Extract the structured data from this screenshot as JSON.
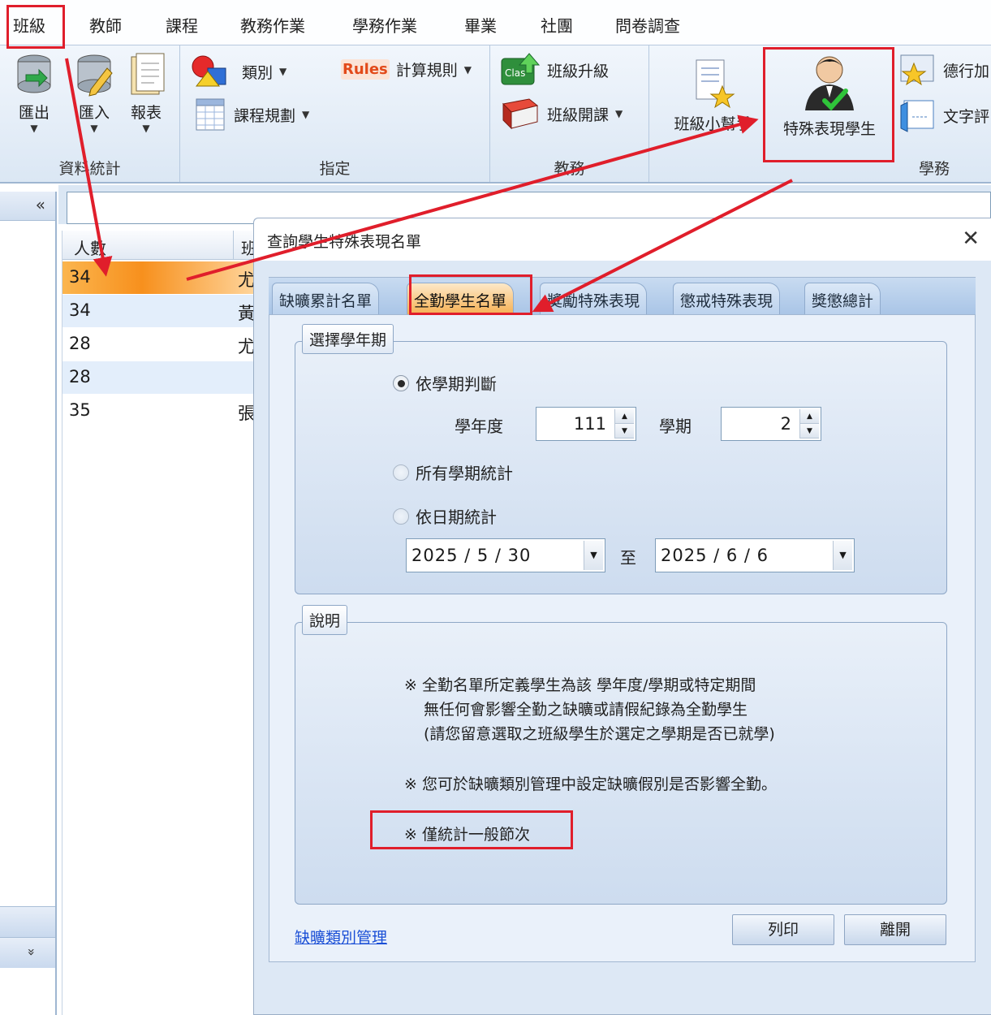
{
  "menu": {
    "items": [
      "班級",
      "教師",
      "課程",
      "教務作業",
      "學務作業",
      "畢業",
      "社團",
      "問卷調查"
    ]
  },
  "ribbon": {
    "data_stats": {
      "label": "資料統計",
      "export": "匯出",
      "import": "匯入",
      "report": "報表"
    },
    "assign": {
      "label": "指定",
      "category": "類別",
      "calc_rules": "計算規則",
      "rules_icon_text": "Rules",
      "course_plan": "課程規劃"
    },
    "academic": {
      "label": "教務",
      "class_upgrade": "班級升級",
      "class_open": "班級開課",
      "class_icon_text": "Clas"
    },
    "student_affairs": {
      "label": "學務",
      "class_helper": "班級小幫手",
      "special_students": "特殊表現學生",
      "moral": "德行加",
      "text_eval": "文字評"
    }
  },
  "nav": {
    "collapse": "«",
    "expand": "»"
  },
  "grid": {
    "headers": [
      "人數",
      "班"
    ],
    "rows": [
      {
        "count": "34",
        "name": "尤"
      },
      {
        "count": "34",
        "name": "黃"
      },
      {
        "count": "28",
        "name": "尤"
      },
      {
        "count": "28",
        "name": ""
      },
      {
        "count": "35",
        "name": "張"
      }
    ]
  },
  "dialog": {
    "title": "查詢學生特殊表現名單",
    "close": "✕",
    "tabs": [
      "缺曠累計名單",
      "全勤學生名單",
      "獎勵特殊表現",
      "懲戒特殊表現",
      "獎懲總計"
    ],
    "active_tab": "全勤學生名單",
    "term_group": {
      "legend": "選擇學年期",
      "by_term": "依學期判斷",
      "year_label": "學年度",
      "year_value": "111",
      "semester_label": "學期",
      "semester_value": "2",
      "all_terms": "所有學期統計",
      "by_date": "依日期統計",
      "date_from": "2025 / 5 / 30",
      "date_to_label": "至",
      "date_to": "2025 / 6 / 6"
    },
    "notes_group": {
      "legend": "說明",
      "lines": [
        "※ 全勤名單所定義學生為該 學年度/學期或特定期間",
        "無任何會影響全勤之缺曠或請假紀錄為全勤學生",
        "(請您留意選取之班級學生於選定之學期是否已就學)",
        "※ 您可於缺曠類別管理中設定缺曠假別是否影響全勤。",
        "※ 僅統計一般節次"
      ]
    },
    "link": "缺曠類別管理",
    "print": "列印",
    "leave": "離開"
  },
  "colors": {
    "annotation": "#e01e2b",
    "selected_row": "#f7901d",
    "link": "#1a4fd6"
  }
}
